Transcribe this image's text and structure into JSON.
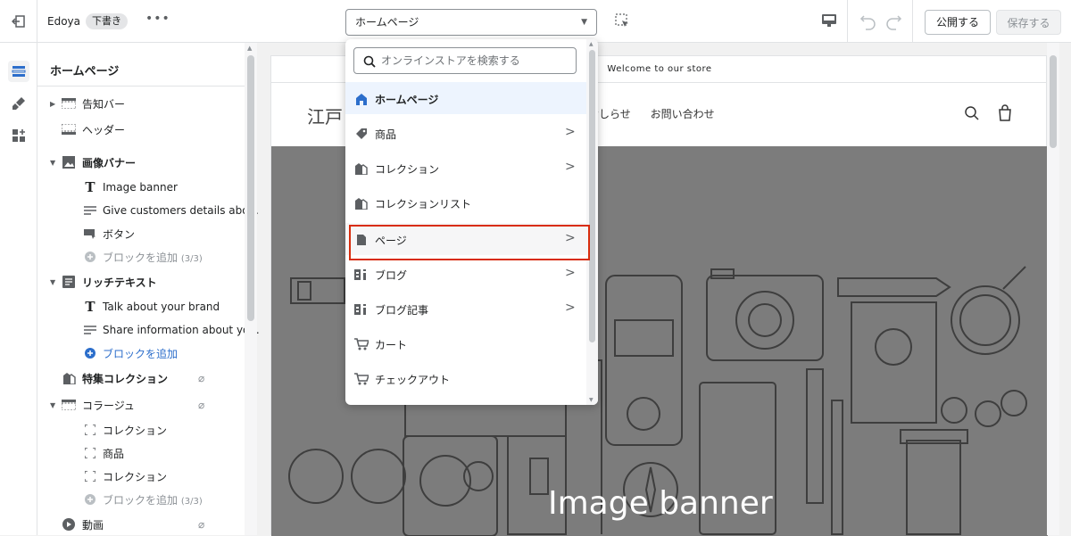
{
  "topbar": {
    "store_name": "Edoya",
    "status_badge": "下書き",
    "more": "•••",
    "page_select_value": "ホームページ",
    "publish_label": "公開する",
    "save_label": "保存する"
  },
  "sidebar": {
    "title": "ホームページ",
    "items": [
      {
        "label": "告知バー"
      },
      {
        "label": "ヘッダー"
      },
      {
        "label": "画像バナー"
      },
      {
        "label": "Image banner"
      },
      {
        "label": "Give customers details abo..."
      },
      {
        "label": "ボタン"
      },
      {
        "label": "ブロックを追加",
        "count": "(3/3)"
      },
      {
        "label": "リッチテキスト"
      },
      {
        "label": "Talk about your brand"
      },
      {
        "label": "Share information about yo..."
      },
      {
        "label": "ブロックを追加"
      },
      {
        "label": "特集コレクション"
      },
      {
        "label": "コラージュ"
      },
      {
        "label": "コレクション"
      },
      {
        "label": "商品"
      },
      {
        "label": "コレクション"
      },
      {
        "label": "ブロックを追加",
        "count": "(3/3)"
      },
      {
        "label": "動画"
      }
    ]
  },
  "dropdown": {
    "search_placeholder": "オンラインストアを検索する",
    "items": [
      {
        "label": "ホームページ",
        "icon": "home-icon"
      },
      {
        "label": "商品",
        "icon": "tag-icon"
      },
      {
        "label": "コレクション",
        "icon": "collection-icon"
      },
      {
        "label": "コレクションリスト",
        "icon": "collection-icon"
      },
      {
        "label": "ページ",
        "icon": "page-icon"
      },
      {
        "label": "ブログ",
        "icon": "blog-icon"
      },
      {
        "label": "ブログ記事",
        "icon": "blog-icon"
      },
      {
        "label": "カート",
        "icon": "cart-icon"
      },
      {
        "label": "チェックアウト",
        "icon": "cart-icon"
      }
    ]
  },
  "preview": {
    "announcement": "Welcome to our store",
    "store_logo": "江戸",
    "nav_links": [
      "おしらせ",
      "お問い合わせ"
    ],
    "banner_title": "Image banner"
  },
  "colors": {
    "accent_blue": "#2c6ecb",
    "highlight_red": "#d82c0d",
    "banner_gray": "#7c7c7c"
  }
}
